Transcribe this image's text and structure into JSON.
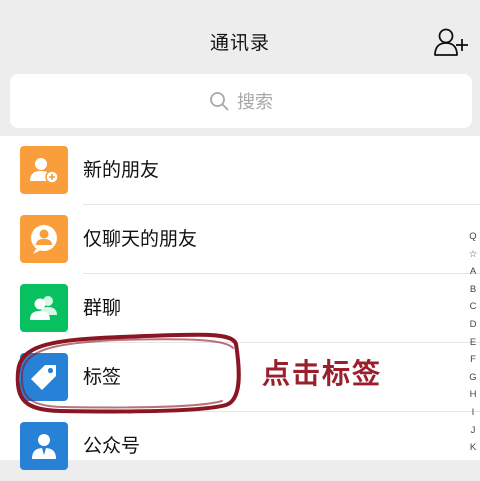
{
  "header": {
    "title": "通讯录",
    "add_friend_icon": "add-contact-icon"
  },
  "search": {
    "placeholder": "搜索",
    "icon": "search-icon"
  },
  "list": {
    "items": [
      {
        "label": "新的朋友",
        "icon": "new-friend-icon",
        "color": "#fa9d3b"
      },
      {
        "label": "仅聊天的朋友",
        "icon": "chat-only-icon",
        "color": "#fa9d3b"
      },
      {
        "label": "群聊",
        "icon": "group-chat-icon",
        "color": "#07c160"
      },
      {
        "label": "标签",
        "icon": "tag-icon",
        "color": "#2782d7"
      },
      {
        "label": "公众号",
        "icon": "official-account-icon",
        "color": "#2782d7"
      }
    ]
  },
  "index_bar": {
    "search_symbol": "Q",
    "star_symbol": "☆",
    "letters": [
      "A",
      "B",
      "C",
      "D",
      "E",
      "F",
      "G",
      "H",
      "I",
      "J",
      "K"
    ]
  },
  "annotation": {
    "text": "点击标签",
    "color": "#9a1f2c"
  }
}
